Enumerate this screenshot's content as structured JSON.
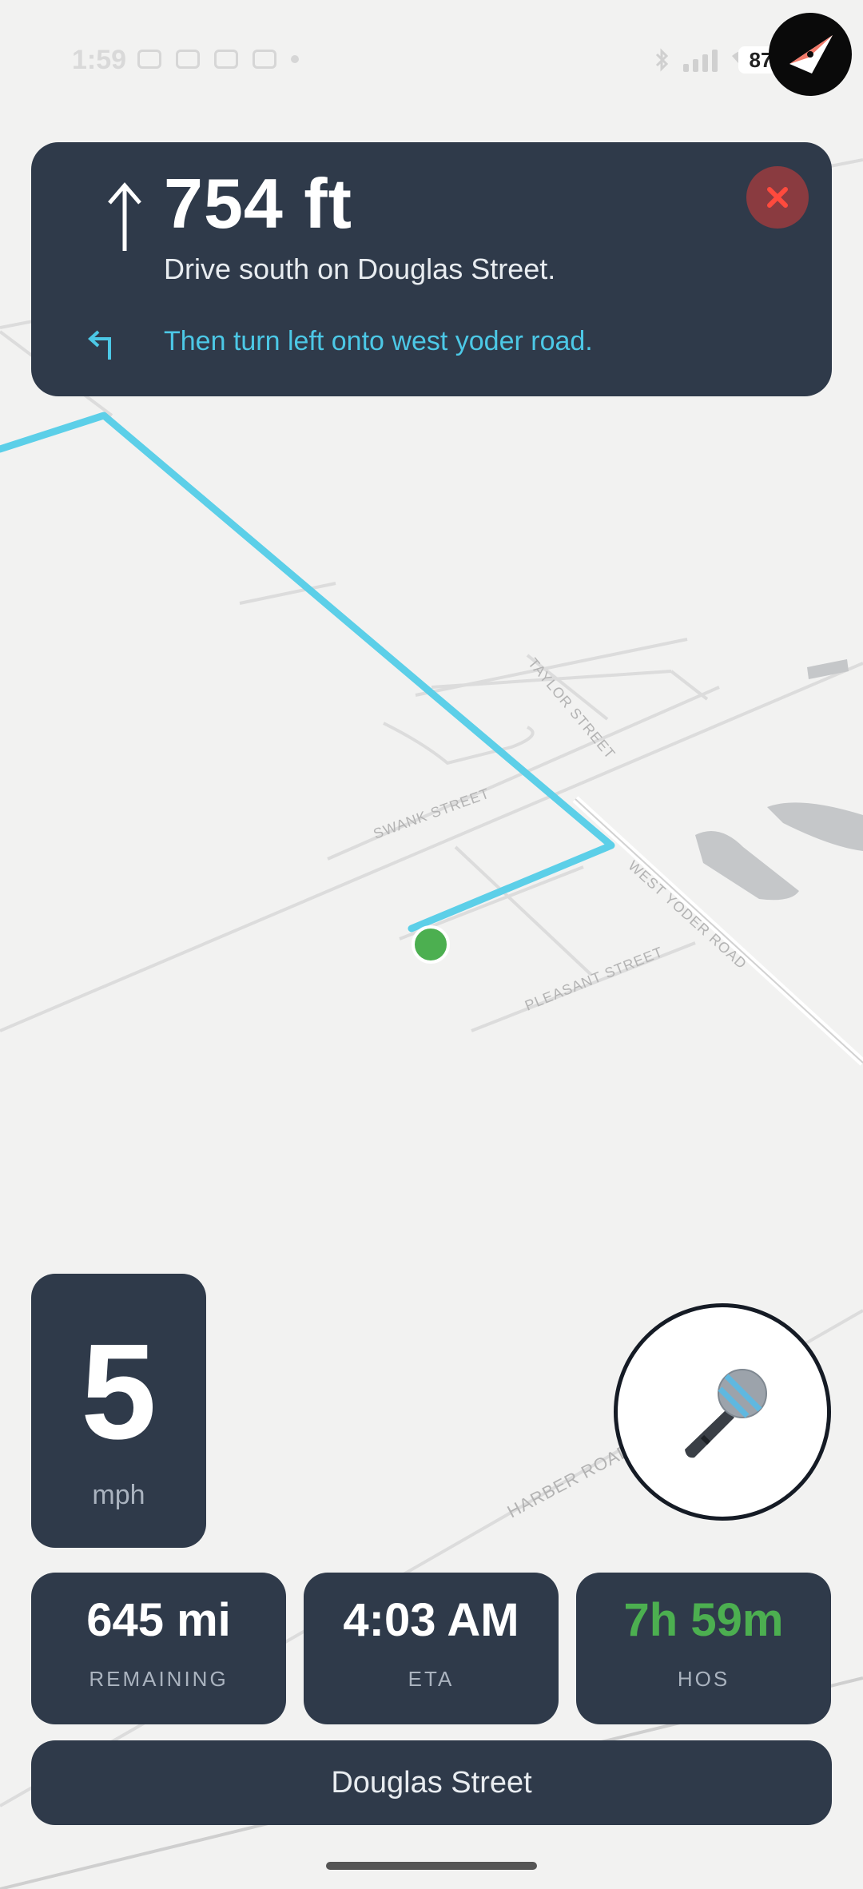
{
  "status_bar": {
    "time": "1:59",
    "battery": "87",
    "left_icons": [
      "messages-icon",
      "mail-stack-icon",
      "gmail-icon",
      "app-icon",
      "dot-icon"
    ],
    "right_icons": [
      "bluetooth-icon",
      "signal-icon",
      "wifi-icon"
    ]
  },
  "instruction": {
    "distance": "754 ft",
    "main_text": "Drive south on Douglas Street.",
    "next_text": "Then turn left onto west yoder road.",
    "accent_color": "#4cc8e6"
  },
  "map": {
    "street_labels": [
      "TAYLOR STREET",
      "SWANK STREET",
      "WEST YODER ROAD",
      "PLEASANT STREET",
      "HARBER ROAD"
    ],
    "route_color": "#5ccfe8",
    "position_color": "#4caf50"
  },
  "speed": {
    "value": "5",
    "unit": "mph"
  },
  "stats": {
    "remaining": {
      "value": "645 mi",
      "label": "REMAINING"
    },
    "eta": {
      "value": "4:03 AM",
      "label": "ETA"
    },
    "hos": {
      "value": "7h 59m",
      "label": "HOS",
      "color": "#4caf50"
    }
  },
  "current_street": "Douglas Street"
}
